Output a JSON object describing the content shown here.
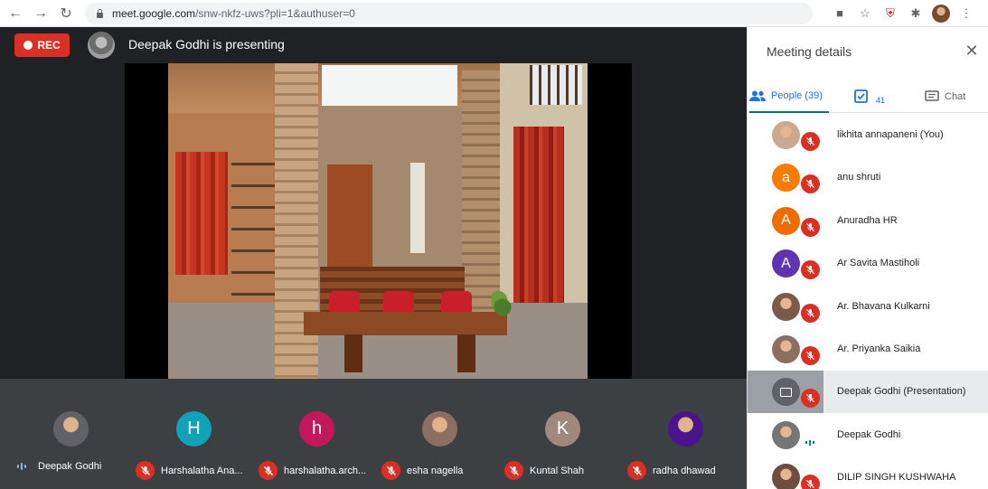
{
  "browser": {
    "url_host": "meet.google.com",
    "url_path": "/snw-nkfz-uws?pli=1&authuser=0"
  },
  "stage": {
    "rec_label": "REC",
    "presenting_text": "Deepak Godhi is presenting"
  },
  "filmstrip": [
    {
      "name": "Deepak Godhi",
      "initial": "",
      "color": "#5f6368",
      "status": "talking"
    },
    {
      "name": "Harshalatha Ana...",
      "initial": "H",
      "color": "#12a2b8",
      "status": "muted"
    },
    {
      "name": "harshalatha.arch...",
      "initial": "h",
      "color": "#c2185b",
      "status": "muted"
    },
    {
      "name": "esha nagella",
      "initial": "",
      "color": "#8d6e63",
      "status": "muted"
    },
    {
      "name": "Kuntal Shah",
      "initial": "K",
      "color": "#a1887f",
      "status": "muted"
    },
    {
      "name": "radha dhawad",
      "initial": "",
      "color": "#4a148c",
      "status": "muted"
    }
  ],
  "panel": {
    "title": "Meeting details",
    "tabs": {
      "people": "People (39)",
      "tasks_count": "41",
      "chat": "Chat"
    },
    "people": [
      {
        "name": "likhita annapaneni (You)",
        "initial": "",
        "color": "#c9a98f",
        "status": "muted"
      },
      {
        "name": "anu shruti",
        "initial": "a",
        "color": "#f57c00",
        "status": "muted"
      },
      {
        "name": "Anuradha HR",
        "initial": "A",
        "color": "#ef6c00",
        "status": "muted"
      },
      {
        "name": "Ar Savita Mastiholi",
        "initial": "A",
        "color": "#5e35b1",
        "status": "muted"
      },
      {
        "name": "Ar. Bhavana Kulkarni",
        "initial": "",
        "color": "#7b5a48",
        "status": "muted"
      },
      {
        "name": "Ar. Priyanka Saikia",
        "initial": "",
        "color": "#8d6e63",
        "status": "muted"
      },
      {
        "name": "Deepak Godhi (Presentation)",
        "initial": "",
        "color": "#5f6368",
        "status": "muted"
      },
      {
        "name": "Deepak Godhi",
        "initial": "",
        "color": "#757575",
        "status": "talking"
      },
      {
        "name": "DILIP SINGH KUSHWAHA",
        "initial": "",
        "color": "#6d4c41",
        "status": "muted"
      }
    ]
  },
  "colors": {
    "accent": "#1a73e8",
    "muted_red": "#d93025",
    "stage_bg": "#202124",
    "filmstrip_bg": "#3c4043"
  },
  "icons": [
    "back-arrow-icon",
    "forward-arrow-icon",
    "reload-icon",
    "lock-icon",
    "camera-icon",
    "star-icon",
    "shield-icon",
    "extensions-icon",
    "profile-avatar-icon",
    "menu-dots-icon",
    "people-icon",
    "tasks-icon",
    "chat-icon",
    "close-icon",
    "mic-off-icon",
    "present-icon"
  ]
}
